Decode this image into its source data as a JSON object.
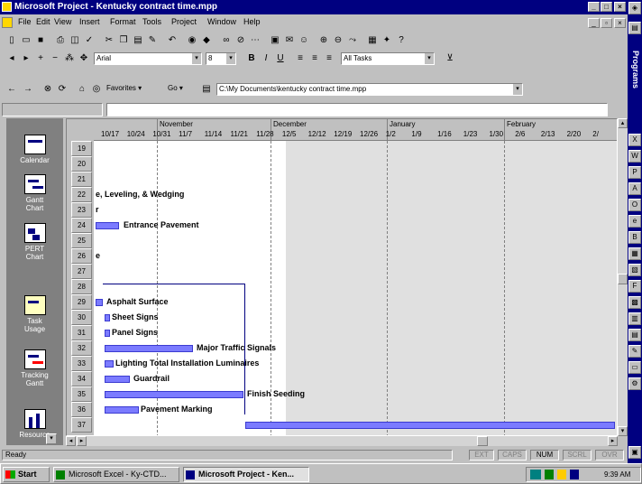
{
  "window": {
    "title": "Microsoft Project - Kentucky contract time.mpp"
  },
  "menu": [
    "File",
    "Edit",
    "View",
    "Insert",
    "Format",
    "Tools",
    "Project",
    "Window",
    "Help"
  ],
  "formatting": {
    "font": "Arial",
    "size": "8",
    "filter": "All Tasks"
  },
  "web": {
    "favorites": "Favorites",
    "go": "Go",
    "address": "C:\\My Documents\\kentucky contract time.mpp"
  },
  "viewbar": [
    "Calendar",
    "Gantt Chart",
    "PERT Chart",
    "Task Usage",
    "Tracking Gantt",
    "Resource"
  ],
  "timescale": {
    "months": [
      "November",
      "December",
      "January",
      "February"
    ],
    "weeks": [
      "10/17",
      "10/24",
      "10/31",
      "11/7",
      "11/14",
      "11/21",
      "11/28",
      "12/5",
      "12/12",
      "12/19",
      "12/26",
      "1/2",
      "1/9",
      "1/16",
      "1/23",
      "1/30",
      "2/6",
      "2/13",
      "2/20",
      "2/"
    ]
  },
  "rows": [
    "19",
    "20",
    "21",
    "22",
    "23",
    "24",
    "25",
    "26",
    "27",
    "28",
    "29",
    "30",
    "31",
    "32",
    "33",
    "34",
    "35",
    "36",
    "37"
  ],
  "tasks": {
    "partial_22": "e, Leveling, & Wedging",
    "partial_23": "r",
    "entrance": "Entrance Pavement",
    "partial_25": "e",
    "asphalt": "Asphalt Surface",
    "sheet_signs": "Sheet Signs",
    "panel_signs": "Panel Signs",
    "traffic_signals": "Major Traffic Signals",
    "lighting": "Lighting Total Installation Luminaires",
    "guardrail": "Guardrail",
    "seeding": "Finish Seeding",
    "marking": "Pavement Marking"
  },
  "status": {
    "ready": "Ready",
    "ext": "EXT",
    "caps": "CAPS",
    "num": "NUM",
    "scrl": "SCRL",
    "ovr": "OVR"
  },
  "taskbar": {
    "start": "Start",
    "excel": "Microsoft Excel - Ky-CTD...",
    "project": "Microsoft Project - Ken...",
    "clock": "9:39 AM"
  },
  "officebar": {
    "label": "Programs"
  },
  "colors": {
    "titlebar": "#000080",
    "bar": "#7b7bff",
    "desktop_gray": "#c0c0c0"
  }
}
